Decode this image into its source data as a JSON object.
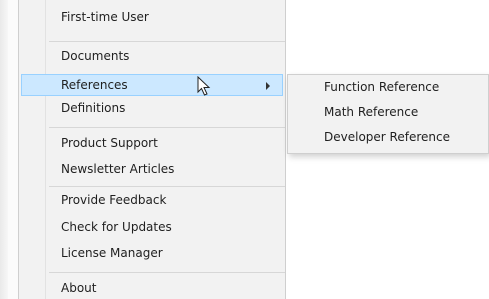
{
  "menu": {
    "items": [
      {
        "label": "First-time User"
      },
      {
        "label": "Documents"
      },
      {
        "label": "References",
        "highlighted": true,
        "has_submenu": true
      },
      {
        "label": "Definitions"
      },
      {
        "label": "Product Support"
      },
      {
        "label": "Newsletter Articles"
      },
      {
        "label": "Provide Feedback"
      },
      {
        "label": "Check for Updates"
      },
      {
        "label": "License Manager"
      },
      {
        "label": "About"
      }
    ]
  },
  "submenu": {
    "parent": "References",
    "items": [
      {
        "label": "Function Reference"
      },
      {
        "label": "Math Reference"
      },
      {
        "label": "Developer Reference"
      }
    ]
  },
  "icons": {
    "submenu_arrow": "chevron-right-icon",
    "cursor": "mouse-pointer-icon"
  },
  "colors": {
    "menu_background": "#f2f2f2",
    "highlight_background": "#cce8ff",
    "highlight_border": "#99d1ff",
    "separator": "#d7d7d7",
    "text": "#1f1f1f"
  }
}
